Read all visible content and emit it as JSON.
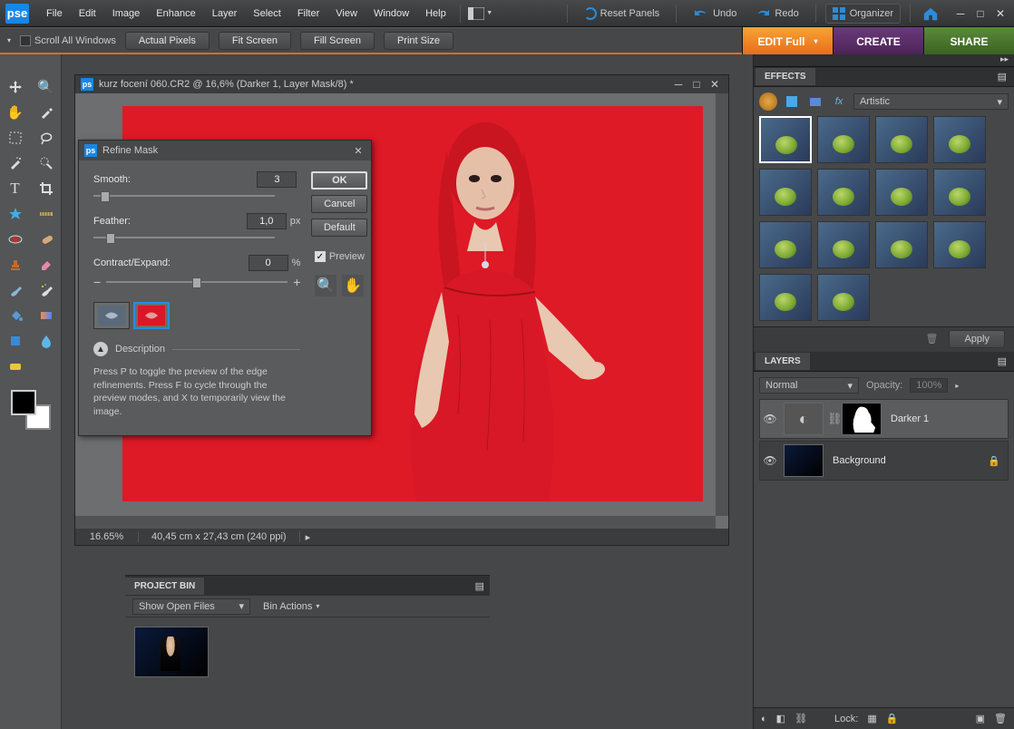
{
  "app_logo": "pse",
  "menu": [
    "File",
    "Edit",
    "Image",
    "Enhance",
    "Layer",
    "Select",
    "Filter",
    "View",
    "Window",
    "Help"
  ],
  "topbar": {
    "reset_panels": "Reset Panels",
    "undo": "Undo",
    "redo": "Redo",
    "organizer": "Organizer"
  },
  "optbar": {
    "scroll_all": "Scroll All Windows",
    "actual_pixels": "Actual Pixels",
    "fit_screen": "Fit Screen",
    "fill_screen": "Fill Screen",
    "print_size": "Print Size"
  },
  "tabs": {
    "edit": "EDIT Full",
    "create": "CREATE",
    "share": "SHARE"
  },
  "doc": {
    "title": "kurz focení 060.CR2 @ 16,6% (Darker 1, Layer Mask/8) *",
    "zoom": "16.65%",
    "dims": "40,45 cm x 27,43 cm (240 ppi)"
  },
  "dialog": {
    "title": "Refine Mask",
    "smooth_label": "Smooth:",
    "smooth_value": "3",
    "feather_label": "Feather:",
    "feather_value": "1,0",
    "feather_unit": "px",
    "contract_label": "Contract/Expand:",
    "contract_value": "0",
    "contract_unit": "%",
    "ok": "OK",
    "cancel": "Cancel",
    "default": "Default",
    "preview": "Preview",
    "desc_heading": "Description",
    "desc_text": "Press P to toggle the preview of the edge refinements. Press F to cycle through the preview modes, and X to temporarily view the image."
  },
  "effects": {
    "tab": "EFFECTS",
    "category": "Artistic",
    "apply": "Apply"
  },
  "layers": {
    "tab": "LAYERS",
    "blend_mode": "Normal",
    "opacity_label": "Opacity:",
    "opacity_value": "100%",
    "items": [
      {
        "name": "Darker 1",
        "locked": false
      },
      {
        "name": "Background",
        "locked": true
      }
    ],
    "lock_label": "Lock:"
  },
  "projectbin": {
    "tab": "PROJECT BIN",
    "show": "Show Open Files",
    "bin_actions": "Bin Actions"
  }
}
